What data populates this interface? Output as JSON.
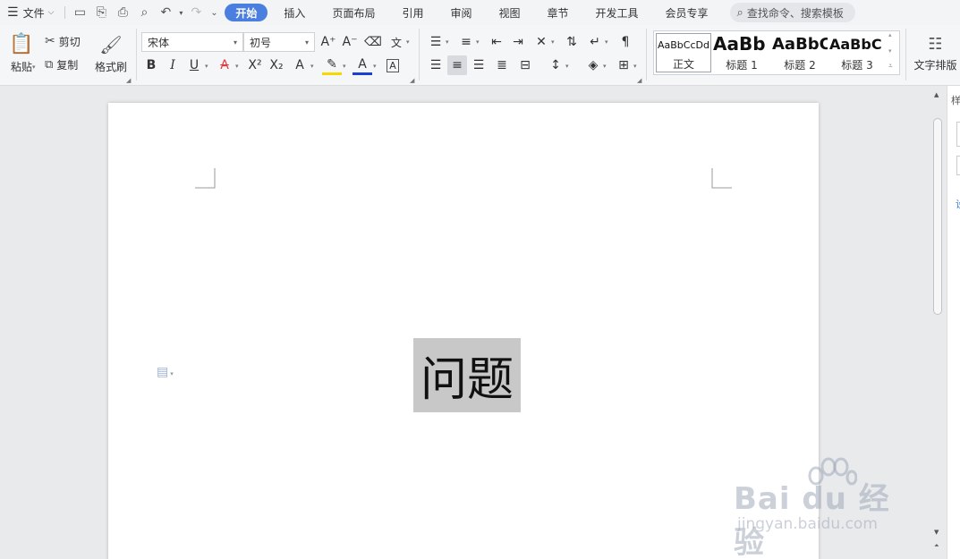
{
  "menubar": {
    "file_label": "文件",
    "tabs": [
      "开始",
      "插入",
      "页面布局",
      "引用",
      "审阅",
      "视图",
      "章节",
      "开发工具",
      "会员专享"
    ],
    "active_tab": "开始",
    "search_placeholder": "查找命令、搜索模板"
  },
  "ribbon": {
    "clipboard": {
      "paste": "粘贴",
      "cut": "剪切",
      "copy": "复制",
      "format_painter": "格式刷"
    },
    "font": {
      "name": "宋体",
      "size": "初号"
    },
    "styles": [
      {
        "preview": "AaBbCcDd",
        "name": "正文"
      },
      {
        "preview": "AaBb",
        "name": "标题 1"
      },
      {
        "preview": "AaBbC",
        "name": "标题 2"
      },
      {
        "preview": "AaBbC",
        "name": "标题 3"
      }
    ],
    "text_layout": "文字排版",
    "font_color_accent": "#e0393e",
    "highlight_accent": "#f5d800",
    "text_color_accent": "#1a3fd1"
  },
  "document": {
    "heading": "问题"
  },
  "watermark": {
    "logo": "Bai du 经验",
    "url": "jingyan.baidu.com"
  },
  "colors": {
    "active_tab_bg": "#4a7fe0",
    "selection_bg": "#c8c8c8"
  }
}
